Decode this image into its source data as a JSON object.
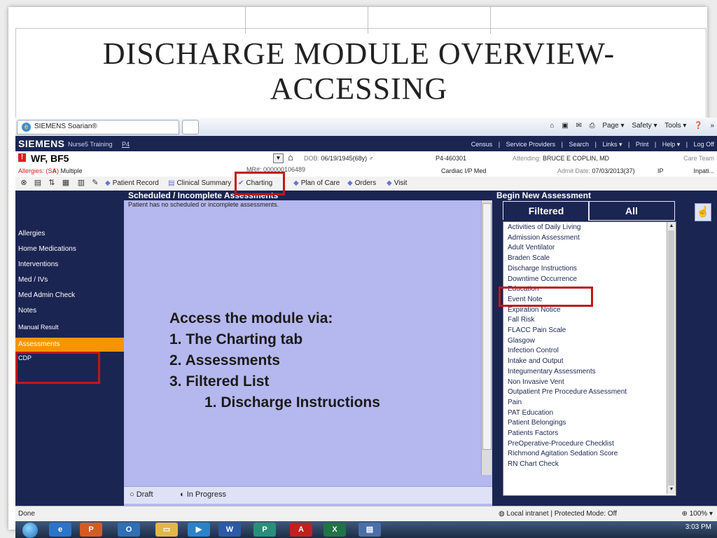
{
  "slide": {
    "title_line1": "DISCHARGE MODULE OVERVIEW-",
    "title_line2": "ACCESSING"
  },
  "browser": {
    "tab_title": "SIEMENS Soarian®",
    "toolbar_items": [
      "Page ▾",
      "Safety ▾",
      "Tools ▾"
    ],
    "chevron": "»"
  },
  "app_header": {
    "logo": "SIEMENS",
    "user": "Nurse5 Training",
    "facility": "P4",
    "right_links": [
      "Census",
      "|",
      "Service Providers",
      "|",
      "Search",
      "|",
      "Links ▾",
      "|",
      "Print",
      "|",
      "Help ▾",
      "|",
      "Log Off"
    ]
  },
  "patient": {
    "name": "WF, BF5",
    "dob_label": "DOB:",
    "dob_value": "06/19/1945(68y)",
    "sex_symbol": "♂",
    "mrn_partial": "MR#: 000000106489",
    "encounter": "P4-460301",
    "attending_label": "Attending:",
    "attending_value": "BRUCE E COPLIN, MD",
    "care_team": "Care Team",
    "allergies_label": "Allergies: (S",
    "allergies_icon": "A",
    "allergies_close": ")",
    "allergies_value": "Multiple",
    "location": "Cardiac I/P Med",
    "admit_label": "Admit Date:",
    "admit_value": "07/03/2013(37)",
    "patient_type": "IP",
    "patient_class": "Inpati..."
  },
  "nav": {
    "items": [
      "Patient Record",
      "Clinical Summary",
      "Charting",
      "Plan of Care",
      "Orders",
      "Visit"
    ]
  },
  "left_nav": {
    "items": [
      "Allergies",
      "Home Medications",
      "Interventions",
      "Med / IVs",
      "Med Admin Check",
      "Notes",
      "Manual Result",
      "Assessments",
      "CDP"
    ]
  },
  "scheduled": {
    "header": "Scheduled / Incomplete Assessments",
    "message": "Patient has no scheduled or incomplete assessments.",
    "legend_draft": "Draft",
    "legend_in_progress": "In Progress"
  },
  "callout": {
    "heading": "Access the module via:",
    "step1": "1.  The Charting tab",
    "step2": "2.  Assessments",
    "step3": "3.  Filtered List",
    "substep": "1.  Discharge Instructions"
  },
  "begin_new": {
    "header": "Begin New Assessment",
    "tab_filtered": "Filtered",
    "tab_all": "All",
    "assessments": [
      "Activities of Daily Living",
      "Admission Assessment",
      "Adult Ventilator",
      "Braden Scale",
      "Discharge Instructions",
      "Downtime Occurrence",
      "Education",
      "Event Note",
      "Expiration Notice",
      "Fall Risk",
      "FLACC Pain Scale",
      "Glasgow",
      "Infection Control",
      "Intake and Output",
      "Integumentary Assessments",
      "Non Invasive Vent",
      "Outpatient Pre Procedure Assessment",
      "Pain",
      "PAT Education",
      "Patient Belongings",
      "Patients Factors",
      "PreOperative-Procedure Checklist",
      "Richmond Agitation Sedation Score",
      "RN Chart Check"
    ]
  },
  "status_bar": {
    "left": "Done",
    "zone": "Local intranet | Protected Mode: Off",
    "zoom": "100%"
  },
  "taskbar": {
    "time": "3:03 PM"
  },
  "colors": {
    "app_navy": "#1b2552",
    "highlight_orange": "#f89400",
    "panel_lavender": "#b5b8ee",
    "callout_red": "#c01818"
  }
}
